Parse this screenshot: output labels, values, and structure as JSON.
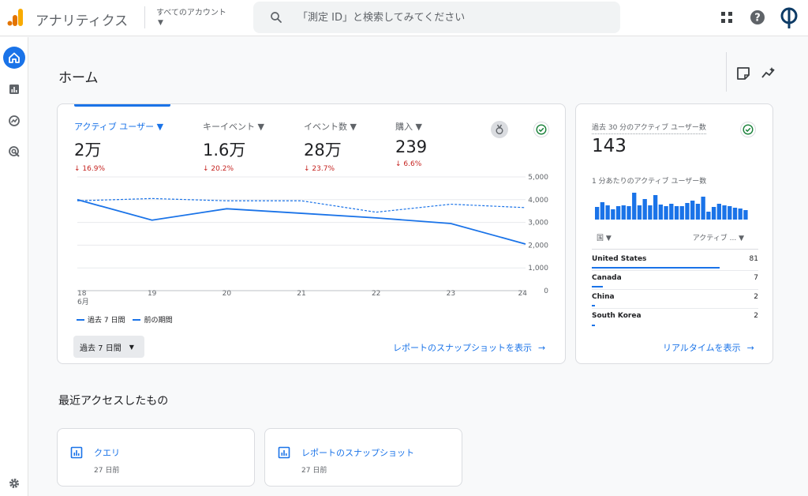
{
  "header": {
    "app_title": "アナリティクス",
    "account_label": "すべてのアカウント",
    "account_caret": "▼",
    "search_placeholder": "「測定 ID」と検索してみてください",
    "logo_colors": [
      "#f9ab00",
      "#e37400"
    ],
    "icons": [
      "apps-icon",
      "help-icon",
      "account-avatar-icon"
    ]
  },
  "sidenav": {
    "items": [
      {
        "name": "home",
        "icon": "home-icon",
        "active": true
      },
      {
        "name": "reports",
        "icon": "bar-chart-icon",
        "active": false
      },
      {
        "name": "explore",
        "icon": "explore-icon",
        "active": false
      },
      {
        "name": "advertising",
        "icon": "advertising-icon",
        "active": false
      }
    ],
    "bottom_icon": "gear-icon"
  },
  "page": {
    "title": "ホーム",
    "tools": [
      "note-icon",
      "insights-icon"
    ]
  },
  "main_card": {
    "metrics": [
      {
        "label": "アクティブ ユーザー",
        "caret": "▼",
        "value": "2万",
        "delta": "↓ 16.9%",
        "active": true
      },
      {
        "label": "キーイベント",
        "caret": "▼",
        "value": "1.6万",
        "delta": "↓ 20.2%",
        "active": false
      },
      {
        "label": "イベント数",
        "caret": "▼",
        "value": "28万",
        "delta": "↓ 23.7%",
        "active": false
      },
      {
        "label": "購入",
        "caret": "▼",
        "value": "239",
        "delta": "↓ 6.6%",
        "active": false
      }
    ],
    "legend": {
      "current": "過去 7 日間",
      "previous": "前の期間"
    },
    "range_select": {
      "label": "過去 7 日間",
      "caret": "▼"
    },
    "snapshot_link": "レポートのスナップショットを表示",
    "arrow": "→",
    "accent_color": "#1a73e8",
    "negative_color": "#c5221f"
  },
  "chart_data": {
    "type": "line",
    "x": [
      "18",
      "19",
      "20",
      "21",
      "22",
      "23",
      "24"
    ],
    "x_sublabel": "6月",
    "y_ticks": [
      "0",
      "1,000",
      "2,000",
      "3,000",
      "4,000",
      "5,000"
    ],
    "ylim": [
      0,
      5000
    ],
    "grid": true,
    "series": [
      {
        "name": "過去 7 日間",
        "style": "solid",
        "values": [
          4000,
          3100,
          3600,
          3400,
          3200,
          2950,
          2050
        ]
      },
      {
        "name": "前の期間",
        "style": "dashed",
        "values": [
          3950,
          4050,
          3950,
          3950,
          3450,
          3800,
          3650
        ]
      }
    ]
  },
  "realtime_card": {
    "label": "過去 30 分のアクティブ ユーザー数",
    "value": "143",
    "sub_label": "1 分あたりのアクティブ ユーザー数",
    "per_minute": [
      16,
      22,
      18,
      13,
      17,
      18,
      17,
      34,
      18,
      26,
      18,
      31,
      19,
      17,
      20,
      17,
      17,
      21,
      24,
      20,
      29,
      10,
      16,
      20,
      18,
      17,
      15,
      14,
      12
    ],
    "col_country": "国",
    "col_active": "アクティブ ...",
    "caret": "▼",
    "rows": [
      {
        "country": "United States",
        "value": 81
      },
      {
        "country": "Canada",
        "value": 7
      },
      {
        "country": "China",
        "value": 2
      },
      {
        "country": "South Korea",
        "value": 2
      }
    ],
    "link": "リアルタイムを表示",
    "arrow": "→"
  },
  "recent": {
    "title": "最近アクセスしたもの",
    "items": [
      {
        "title": "クエリ",
        "sub": "27 日前",
        "icon": "report-icon"
      },
      {
        "title": "レポートのスナップショット",
        "sub": "27 日前",
        "icon": "report-icon"
      }
    ]
  }
}
